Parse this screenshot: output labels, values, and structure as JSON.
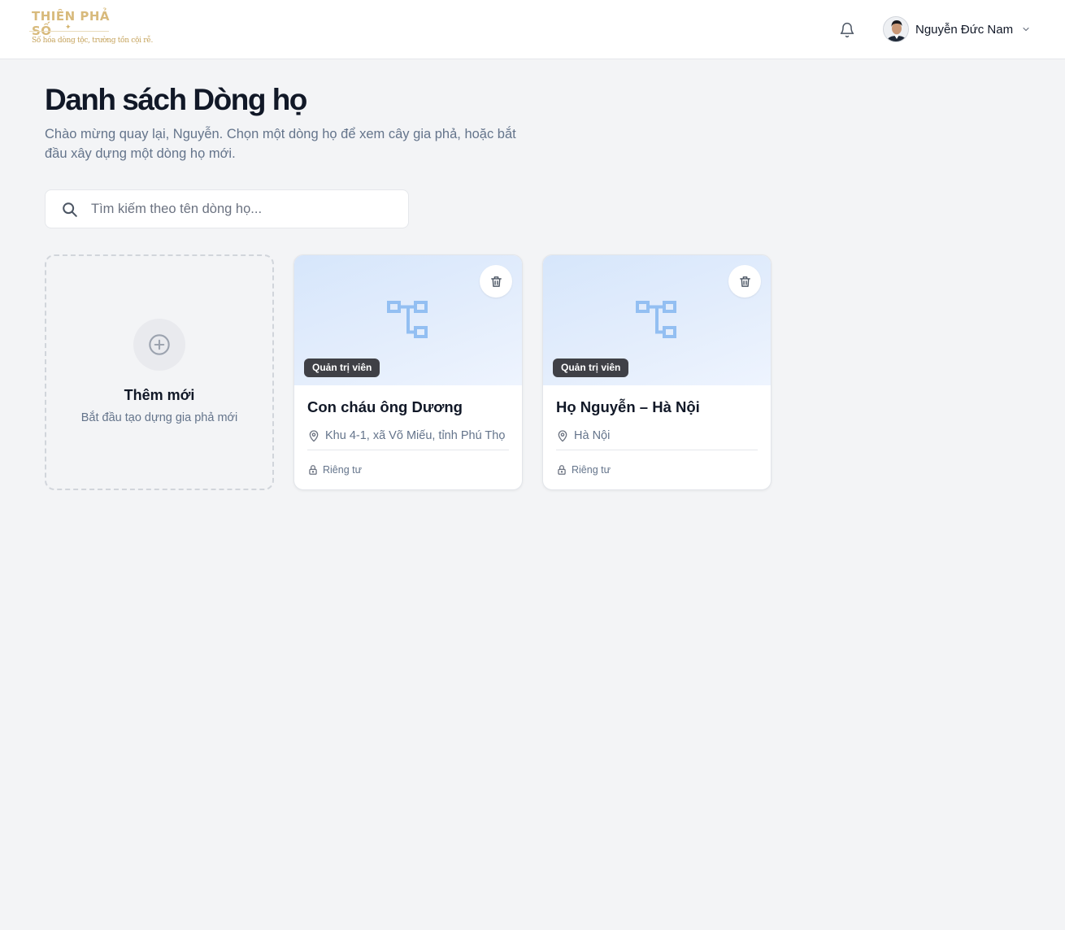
{
  "header": {
    "logo": {
      "title": "THIÊN PHẢ SỐ",
      "slogan": "Số hóa dòng tộc, trường tồn cội rễ."
    },
    "notification_icon": "bell-icon",
    "user": {
      "name": "Nguyễn Đức Nam",
      "avatar_icon": "user-avatar",
      "menu_icon": "chevron-down-icon"
    }
  },
  "page": {
    "title": "Danh sách Dòng họ",
    "subtitle": "Chào mừng quay lại, Nguyễn. Chọn một dòng họ để xem cây gia phả, hoặc bắt đầu xây dựng một dòng họ mới."
  },
  "search": {
    "placeholder": "Tìm kiếm theo tên dòng họ...",
    "value": "",
    "icon": "search-icon"
  },
  "add_card": {
    "title": "Thêm mới",
    "subtitle": "Bắt đầu tạo dựng gia phả mới",
    "icon": "plus-circle-icon"
  },
  "families": [
    {
      "name": "Con cháu ông Dương",
      "location": "Khu 4-1, xã Võ Miếu, tỉnh Phú Thọ",
      "role": "Quản trị viên",
      "privacy": "Riêng tư"
    },
    {
      "name": "Họ Nguyễn – Hà Nội",
      "location": "Hà Nội",
      "role": "Quản trị viên",
      "privacy": "Riêng tư"
    }
  ],
  "colors": {
    "background": "#f3f4f6",
    "card_banner": "#d6e6fb",
    "tree_icon": "#93bff2",
    "badge": "#3f4046",
    "logo_gold": "#d8ba7c"
  }
}
